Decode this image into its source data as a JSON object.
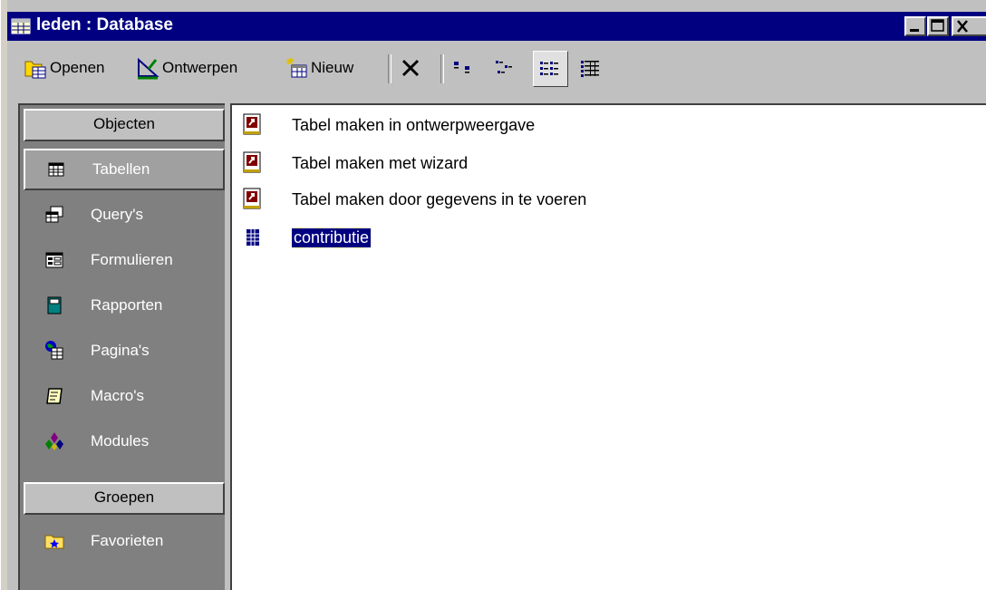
{
  "window": {
    "title": "leden : Database",
    "title_icon": "database-window-icon",
    "buttons": [
      "minimize",
      "maximize",
      "close"
    ]
  },
  "toolbar": {
    "open_label": "Openen",
    "design_label": "Ontwerpen",
    "new_label": "Nieuw",
    "delete_icon": "delete-x-icon",
    "view_icons": [
      "large-icons-view-icon",
      "small-icons-view-icon",
      "list-view-icon",
      "details-view-icon"
    ]
  },
  "sidebar": {
    "objects_header": "Objecten",
    "items": [
      {
        "label": "Tabellen",
        "icon": "table-icon"
      },
      {
        "label": "Query's",
        "icon": "query-icon"
      },
      {
        "label": "Formulieren",
        "icon": "form-icon"
      },
      {
        "label": "Rapporten",
        "icon": "report-icon"
      },
      {
        "label": "Pagina's",
        "icon": "page-icon"
      },
      {
        "label": "Macro's",
        "icon": "macro-icon"
      },
      {
        "label": "Modules",
        "icon": "module-icon"
      }
    ],
    "groups_header": "Groepen",
    "groups": [
      {
        "label": "Favorieten",
        "icon": "favorites-folder-icon"
      }
    ]
  },
  "list": {
    "items": [
      {
        "label": "Tabel maken in ontwerpweergave",
        "icon": "shortcut-icon"
      },
      {
        "label": "Tabel maken met wizard",
        "icon": "shortcut-icon"
      },
      {
        "label": "Tabel maken door gegevens in te voeren",
        "icon": "shortcut-icon"
      },
      {
        "label": "contributie",
        "icon": "table-icon",
        "selected": true
      }
    ]
  },
  "colors": {
    "title_bar": "#000080",
    "sidebar_bg": "#808080",
    "face": "#c0c0c0",
    "selection": "#000080"
  }
}
